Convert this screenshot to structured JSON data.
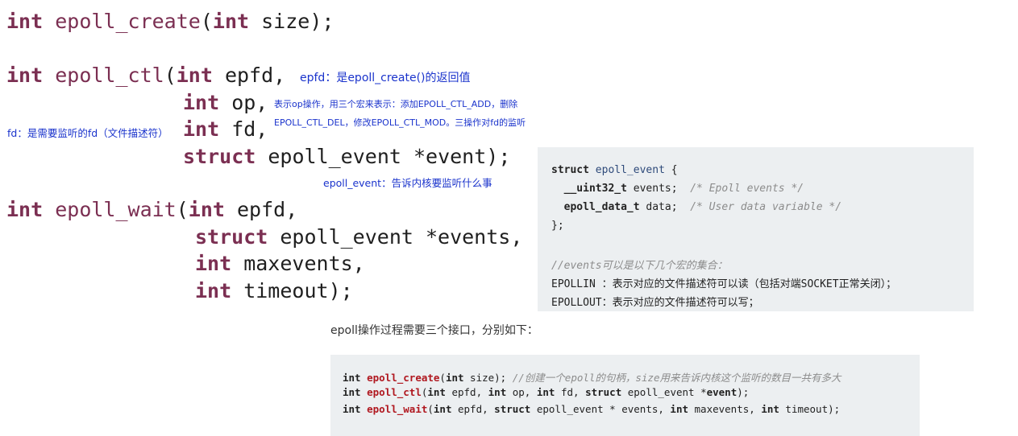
{
  "figure": {
    "create": {
      "kw": "int",
      "fn": "epoll_create",
      "rest_open": "(",
      "arg_kw": "int",
      "rest": " size);"
    },
    "ctl": {
      "kw": "int",
      "fn": "epoll_ctl",
      "rest_open": "(",
      "arg1_kw": "int",
      "arg1": " epfd,",
      "arg2_kw": "int",
      "arg2": " op,",
      "arg3_kw": "int",
      "arg3": " fd,",
      "arg4_kw": "struct",
      "arg4": " epoll_event *event);"
    },
    "wait": {
      "kw": "int",
      "fn": "epoll_wait",
      "rest_open": "(",
      "arg1_kw": "int",
      "arg1": " epfd,",
      "arg2_kw": "struct",
      "arg2": " epoll_event *events,",
      "arg3_kw": "int",
      "arg3": " maxevents,",
      "arg4_kw": "int",
      "arg4": " timeout);"
    }
  },
  "annotations": {
    "epfd": "epfd：是epoll_create()的返回值",
    "op_line1": "表示op操作，用三个宏来表示：添加EPOLL_CTL_ADD，删除",
    "op_line2": "EPOLL_CTL_DEL，修改EPOLL_CTL_MOD。三操作对fd的监听",
    "fd": "fd：是需要监听的fd（文件描述符）",
    "event": "epoll_event：告诉内核要监听什么事"
  },
  "struct_box": {
    "l1_kw": "struct",
    "l1_ty": "epoll_event",
    "l1_rest": " {",
    "l2_ty": "__uint32_t",
    "l2_field": " events;  ",
    "l2_cm": "/* Epoll events */",
    "l3_ty": "epoll_data_t",
    "l3_field": " data;  ",
    "l3_cm": "/* User data variable */",
    "l4": "};",
    "l5_cm": "//events可以是以下几个宏的集合：",
    "l6": "EPOLLIN ：表示对应的文件描述符可以读（包括对端SOCKET正常关闭）；",
    "l7": "EPOLLOUT：表示对应的文件描述符可以写；"
  },
  "caption": "epoll操作过程需要三个接口，分别如下：",
  "api_box": {
    "r1_kw": "int",
    "r1_fn": "epoll_create",
    "r1_open": "(",
    "r1_argkw": "int",
    "r1_rest": " size); ",
    "r1_cm": "//创建一个epoll的句柄，size用来告诉内核这个监听的数目一共有多大",
    "r2_kw": "int",
    "r2_fn": "epoll_ctl",
    "r2_open": "(",
    "r2_a1kw": "int",
    "r2_a1": " epfd, ",
    "r2_a2kw": "int",
    "r2_a2": " op, ",
    "r2_a3kw": "int",
    "r2_a3": " fd, ",
    "r2_a4kw": "struct",
    "r2_a4": " epoll_event *",
    "r2_a4b": "event",
    "r2_end": ");",
    "r3_kw": "int",
    "r3_fn": "epoll_wait",
    "r3_open": "(",
    "r3_a1kw": "int",
    "r3_a1": " epfd, ",
    "r3_a2kw": "struct",
    "r3_a2": " epoll_event * events, ",
    "r3_a3kw": "int",
    "r3_a3": " maxevents, ",
    "r3_a4kw": "int",
    "r3_a4": " timeout);"
  }
}
